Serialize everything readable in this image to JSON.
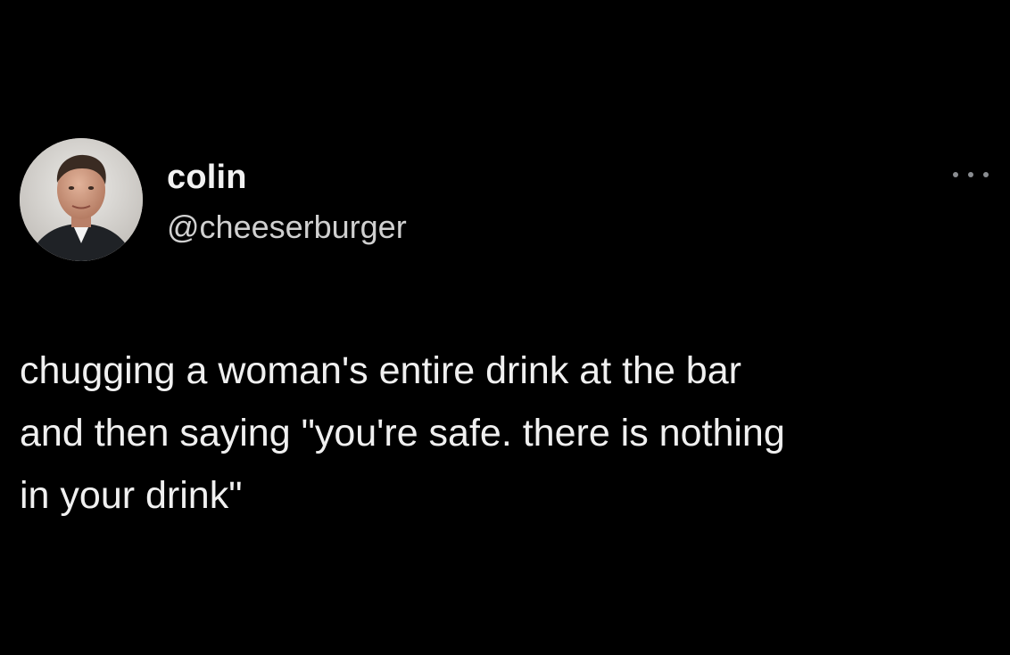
{
  "tweet": {
    "author": {
      "display_name": "colin",
      "handle": "@cheeserburger"
    },
    "text_lines": [
      "chugging a woman's entire drink at the bar",
      "and then saying \"you're safe. there is nothing",
      "in your drink\""
    ],
    "more_icon": "more-horizontal-icon"
  },
  "colors": {
    "background": "#000000",
    "text": "#f0f0f0",
    "secondary_text": "#d0d0d0",
    "icon": "#8a8d91"
  }
}
